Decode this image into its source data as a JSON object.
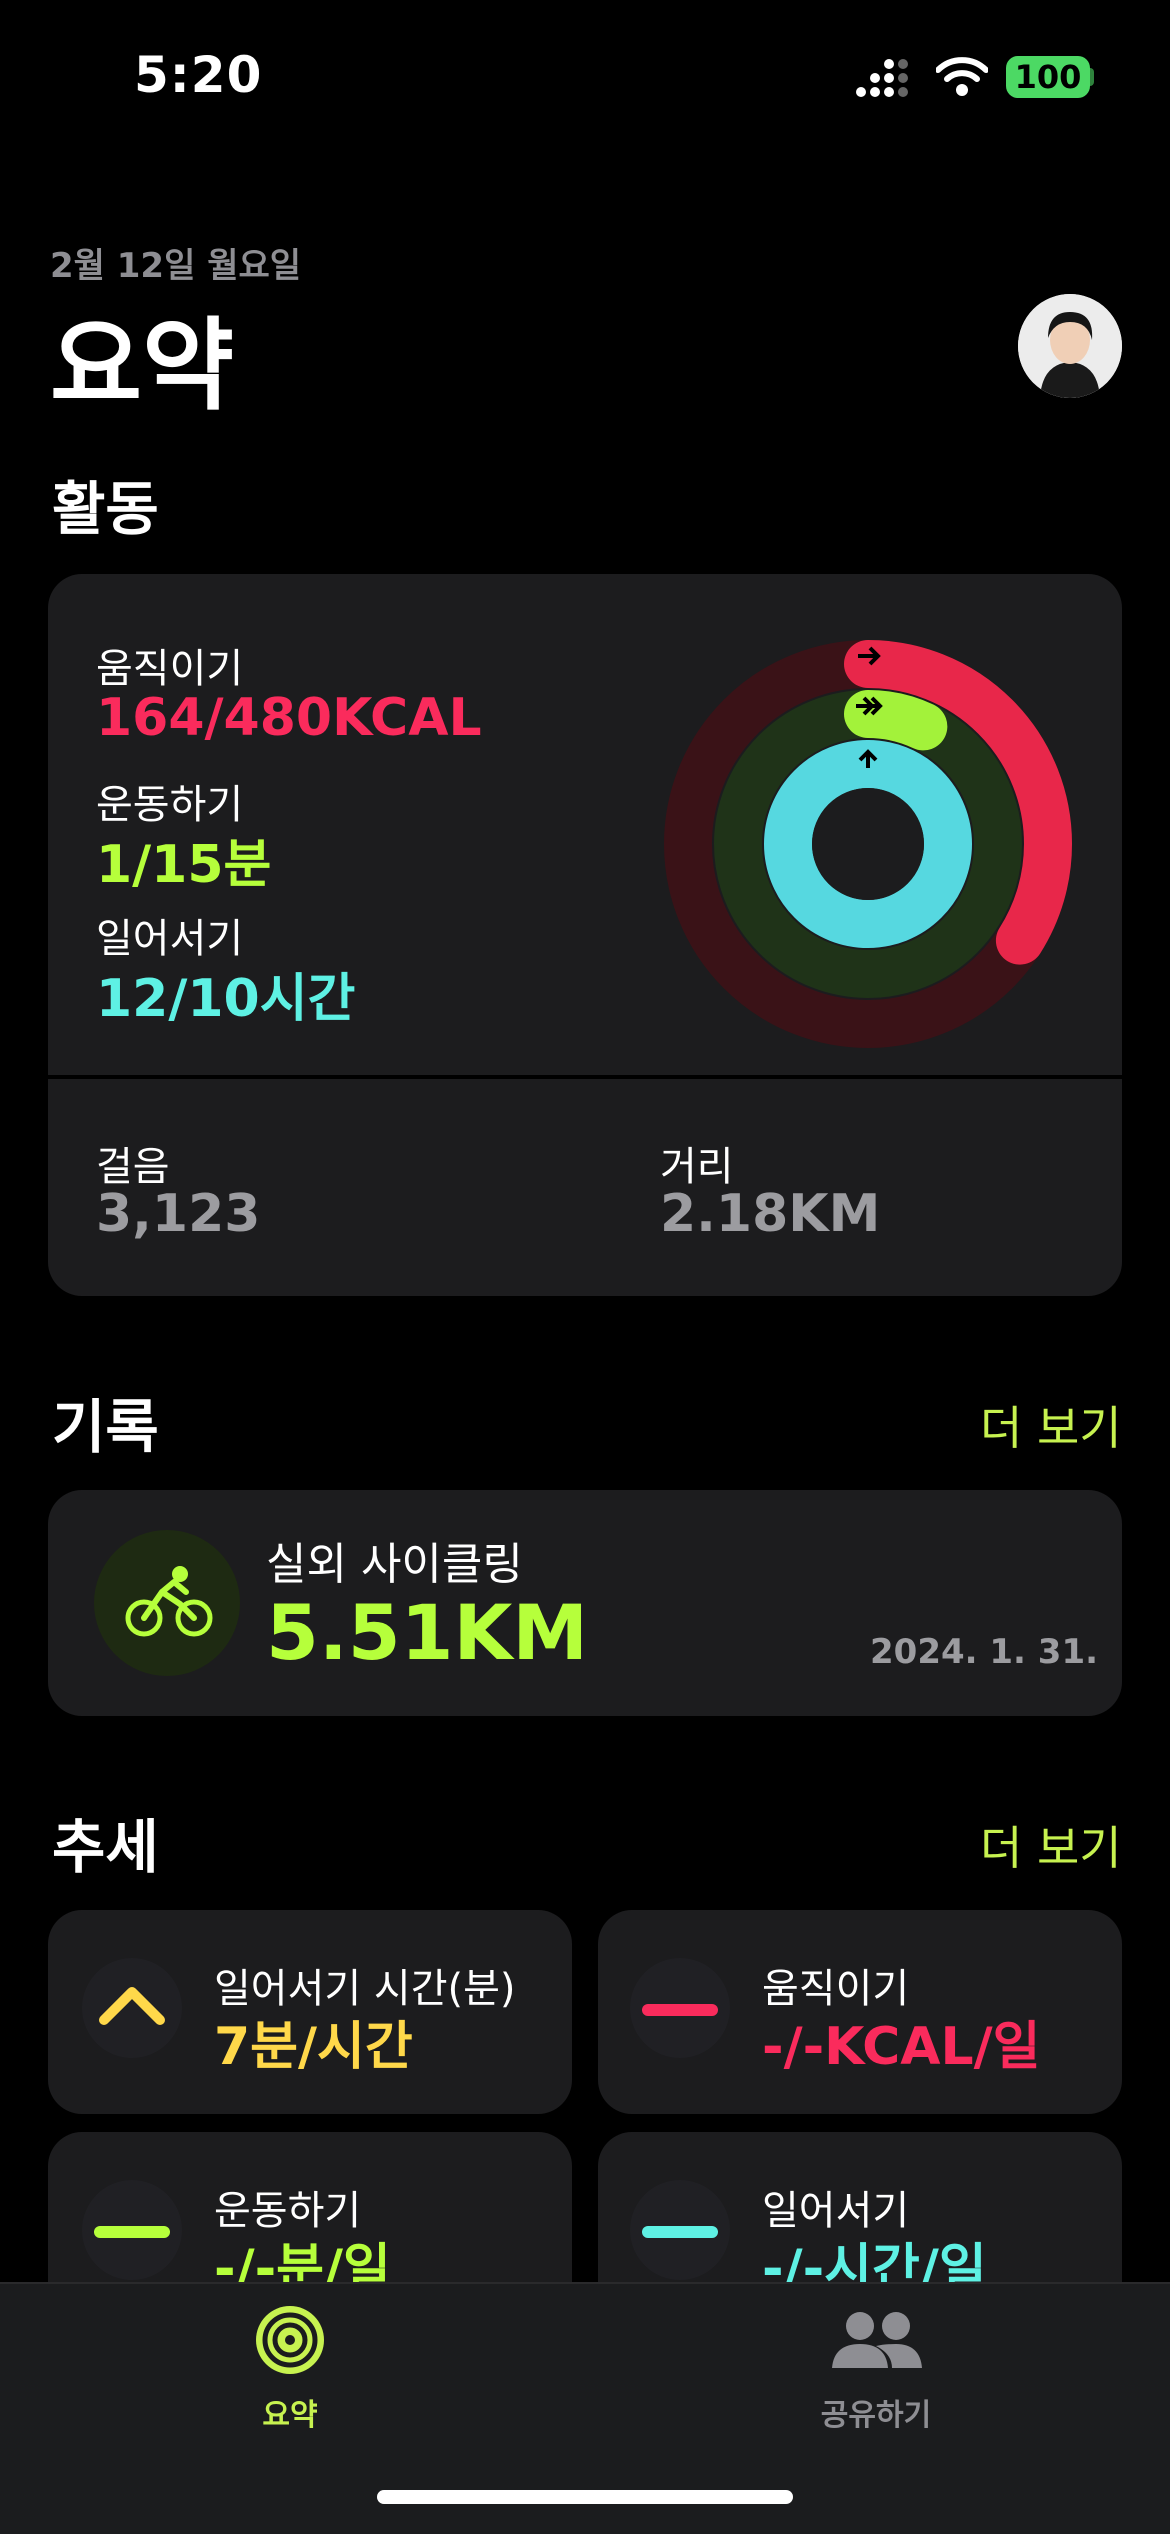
{
  "status": {
    "time": "5:20",
    "battery": "100"
  },
  "header": {
    "date": "2월 12일 월요일",
    "title": "요약"
  },
  "activity": {
    "section_title": "활동",
    "move": {
      "label": "움직이기",
      "value": "164/480KCAL",
      "progress": 0.34
    },
    "exercise": {
      "label": "운동하기",
      "value": "1/15분",
      "progress": 0.07
    },
    "stand": {
      "label": "일어서기",
      "value": "12/10시간",
      "progress": 1.2
    },
    "steps": {
      "label": "걸음",
      "value": "3,123"
    },
    "distance": {
      "label": "거리",
      "value": "2.18KM"
    }
  },
  "history": {
    "section_title": "기록",
    "more": "더 보기",
    "workout": {
      "name": "실외 사이클링",
      "value": "5.51KM",
      "date": "2024. 1. 31."
    }
  },
  "trends": {
    "section_title": "추세",
    "more": "더 보기",
    "items": [
      {
        "label": "일어서기 시간(분)",
        "value": "7분/시간",
        "icon": "chevron-up-icon",
        "color": "#ffd84a"
      },
      {
        "label": "움직이기",
        "value": "-/-KCAL/일",
        "icon": "dash-icon",
        "color": "#fa2b5c"
      },
      {
        "label": "운동하기",
        "value": "-/-분/일",
        "icon": "dash-icon",
        "color": "#b6ff3b"
      },
      {
        "label": "일어서기",
        "value": "-/-시간/일",
        "icon": "dash-icon",
        "color": "#5ef1e4"
      }
    ]
  },
  "tabbar": {
    "tabs": [
      {
        "label": "요약",
        "icon": "activity-rings-icon",
        "active": true
      },
      {
        "label": "공유하기",
        "icon": "people-icon",
        "active": false
      }
    ]
  },
  "colors": {
    "accent": "#c7f250",
    "move": "#fa2b5c",
    "exercise": "#b6ff3b",
    "stand": "#5ef1e4"
  }
}
